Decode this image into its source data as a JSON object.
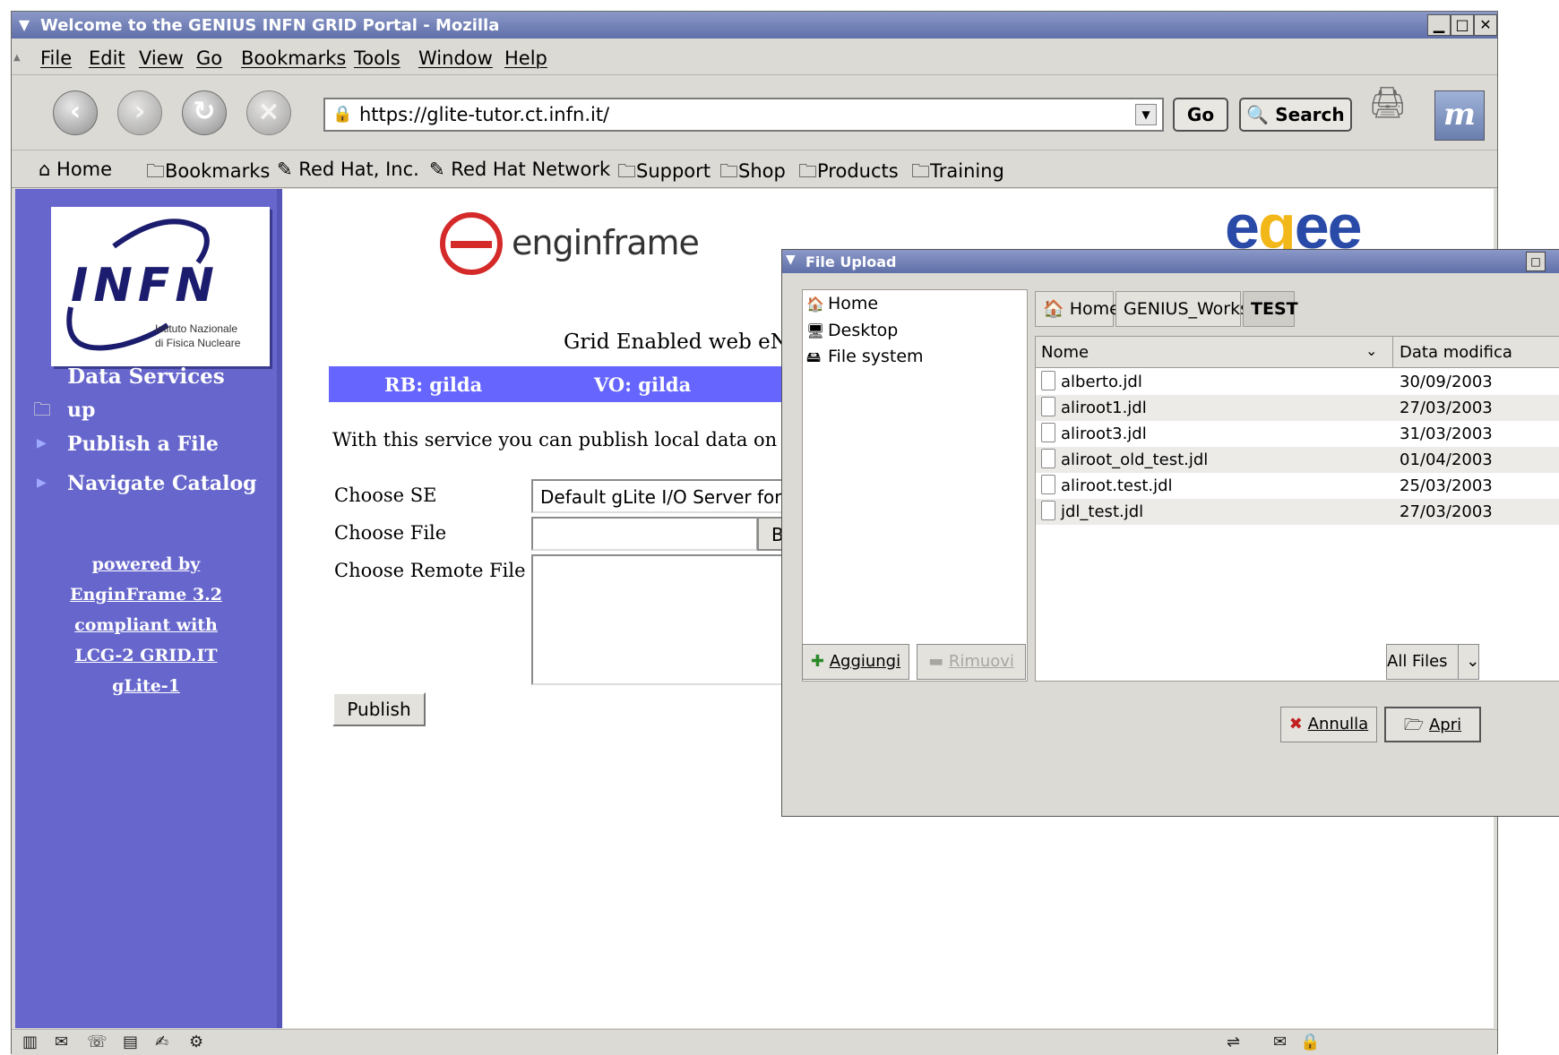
{
  "window": {
    "title": "Welcome to the GENIUS INFN GRID Portal - Mozilla"
  },
  "menu": [
    "File",
    "Edit",
    "View",
    "Go",
    "Bookmarks",
    "Tools",
    "Window",
    "Help"
  ],
  "nav": {
    "url": "https://glite-tutor.ct.infn.it/",
    "go_label": "Go",
    "search_label": "Search"
  },
  "bookmarks": [
    "Home",
    "Bookmarks",
    "Red Hat, Inc.",
    "Red Hat Network",
    "Support",
    "Shop",
    "Products",
    "Training"
  ],
  "sidebar": {
    "logo_text": "INFN",
    "logo_sub1": "Istituto Nazionale",
    "logo_sub2": "di Fisica Nucleare",
    "section_title": "Data Services",
    "links": [
      "up",
      "Publish a File",
      "Navigate Catalog"
    ],
    "footer": [
      "powered by",
      "EnginFrame 3.2",
      "compliant with",
      "LCG-2 GRID.IT",
      "gLite-1"
    ]
  },
  "main": {
    "enginframe_logo": "enginframe",
    "egee_logo": "egee",
    "grid_title": "Grid Enabled web eNvi",
    "rb_label": "RB: gilda",
    "vo_label": "VO: gilda",
    "intro": "With this service you can publish local data on the",
    "choose_se_label": "Choose SE",
    "choose_se_value": "Default gLite I/O Server for thi",
    "choose_file_label": "Choose File",
    "browse_label": "Bro",
    "choose_remote_label": "Choose Remote File",
    "publish_label": "Publish"
  },
  "dialog": {
    "title": "File Upload",
    "places": [
      "Home",
      "Desktop",
      "File system"
    ],
    "breadcrumbs": [
      "Home",
      "GENIUS_Works",
      "TEST"
    ],
    "columns": [
      "Nome",
      "Data modifica"
    ],
    "files": [
      {
        "name": "alberto.jdl",
        "date": "30/09/2003"
      },
      {
        "name": "aliroot1.jdl",
        "date": "27/03/2003"
      },
      {
        "name": "aliroot3.jdl",
        "date": "31/03/2003"
      },
      {
        "name": "aliroot_old_test.jdl",
        "date": "01/04/2003"
      },
      {
        "name": "aliroot.test.jdl",
        "date": "25/03/2003"
      },
      {
        "name": "jdl_test.jdl",
        "date": "27/03/2003"
      }
    ],
    "add_label": "Aggiungi",
    "remove_label": "Rimuovi",
    "filter_label": "All Files",
    "cancel_label": "Annulla",
    "open_label": "Apri"
  },
  "colors": {
    "sidebar": "#6666cc",
    "bluebar": "#6666ff",
    "titlebar": "#5f6fa8",
    "enginframe_red": "#d42a2a",
    "egee_blue": "#2a4aa8",
    "egee_orange": "#f2b81a"
  }
}
